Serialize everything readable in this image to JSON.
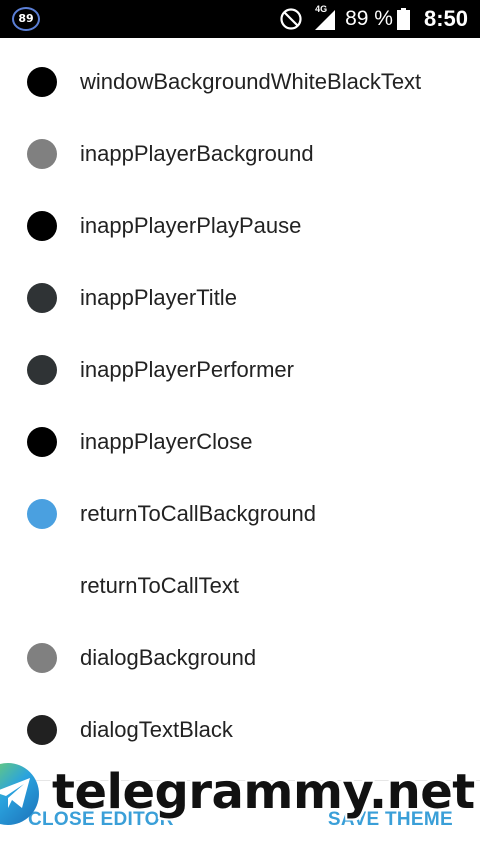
{
  "status_bar": {
    "badge": "89",
    "network": "4G",
    "battery": "89 %",
    "time": "8:50"
  },
  "colors": {
    "accent": "#3a9fd8",
    "status_badge": "#5b7fd6"
  },
  "items": [
    {
      "label": "windowBackgroundWhiteBlackText",
      "color": "#000000"
    },
    {
      "label": "inappPlayerBackground",
      "color": "#808080"
    },
    {
      "label": "inappPlayerPlayPause",
      "color": "#000000"
    },
    {
      "label": "inappPlayerTitle",
      "color": "#2f3335"
    },
    {
      "label": "inappPlayerPerformer",
      "color": "#2f3335"
    },
    {
      "label": "inappPlayerClose",
      "color": "#000000"
    },
    {
      "label": "returnToCallBackground",
      "color": "#4aa0e0"
    },
    {
      "label": "returnToCallText",
      "color": "#ffffff"
    },
    {
      "label": "dialogBackground",
      "color": "#808080"
    },
    {
      "label": "dialogTextBlack",
      "color": "#212121"
    }
  ],
  "footer": {
    "close_label": "CLOSE EDITOR",
    "save_label": "SAVE THEME"
  },
  "watermark": {
    "text": "telegrammy.net"
  }
}
